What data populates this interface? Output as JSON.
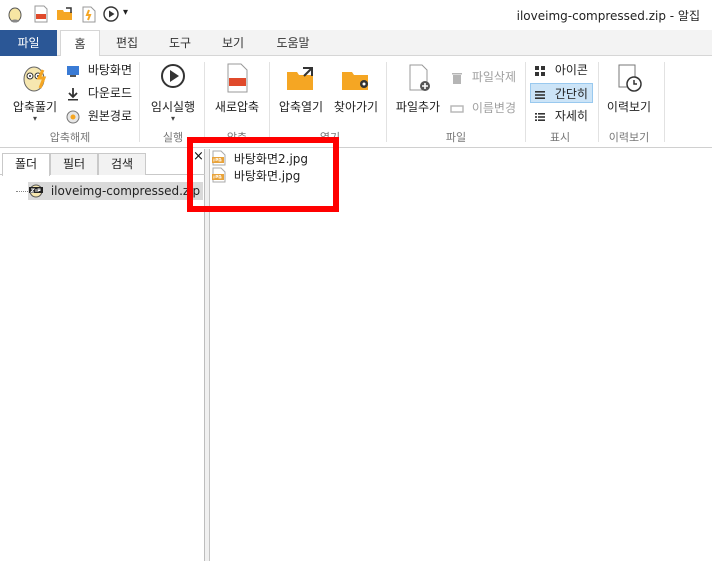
{
  "window": {
    "title": "iloveimg-compressed.zip - 알집"
  },
  "quick_access": {
    "dropdown_glyph": "▾"
  },
  "tabs": [
    {
      "label": "파일"
    },
    {
      "label": "홈"
    },
    {
      "label": "편집"
    },
    {
      "label": "도구"
    },
    {
      "label": "보기"
    },
    {
      "label": "도움말"
    }
  ],
  "ribbon": {
    "extract_group": {
      "label": "압축해제",
      "extract_button": "압축풀기",
      "dropdown_glyph": "▾",
      "desktop": "바탕화면",
      "downloads": "다운로드",
      "original_path": "원본경로"
    },
    "run_group": {
      "label": "실행",
      "temp_run": "임시실행",
      "dropdown_glyph": "▾"
    },
    "compress_group": {
      "label": "압축",
      "new_compress": "새로압축"
    },
    "open_group": {
      "label": "열기",
      "open_archive": "압축열기",
      "find": "찾아가기"
    },
    "file_group": {
      "label": "파일",
      "add_file": "파일추가",
      "delete_file": "파일삭제",
      "rename": "이름변경"
    },
    "view_group": {
      "label": "표시",
      "icons": "아이콘",
      "simple": "간단히",
      "details": "자세히"
    },
    "history_group": {
      "label": "이력보기",
      "history": "이력보기"
    }
  },
  "left_pane": {
    "tabs": [
      {
        "label": "폴더"
      },
      {
        "label": "필터"
      },
      {
        "label": "검색"
      }
    ],
    "tree_item": "iloveimg-compressed.zip"
  },
  "right_pane": {
    "close_glyph": "×",
    "files": [
      {
        "name": "바탕화면2.jpg"
      },
      {
        "name": "바탕화면.jpg"
      }
    ]
  },
  "colors": {
    "file_tab": "#2b5796",
    "highlight": "#ff0000",
    "selected": "#cce4f7",
    "folder": "#f5a623"
  }
}
